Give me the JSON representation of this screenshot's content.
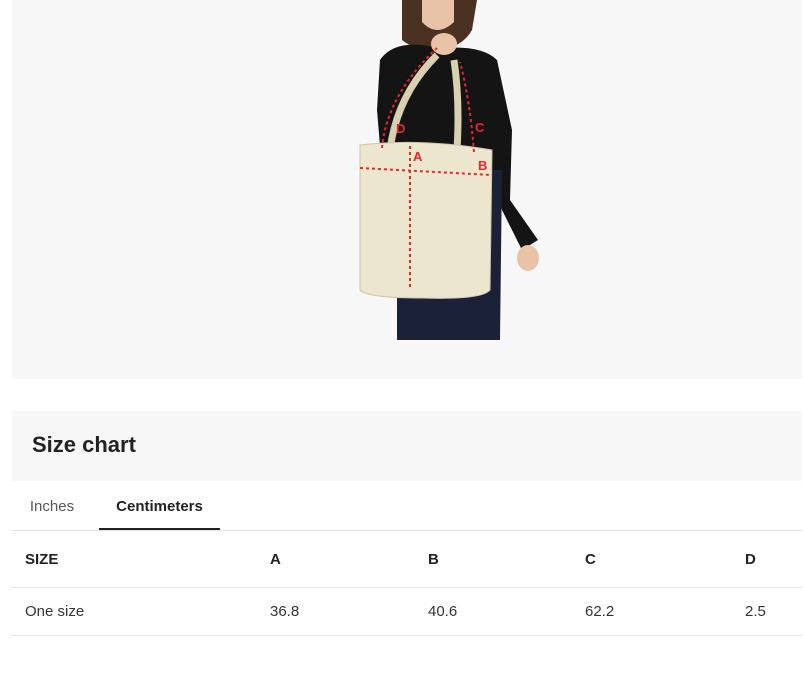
{
  "product_image": {
    "labels": [
      "A",
      "B",
      "C",
      "D"
    ]
  },
  "size_chart": {
    "title": "Size chart",
    "tabs": [
      {
        "label": "Inches",
        "active": false
      },
      {
        "label": "Centimeters",
        "active": true
      }
    ],
    "columns": [
      "SIZE",
      "A",
      "B",
      "C",
      "D"
    ],
    "rows": [
      [
        "One size",
        "36.8",
        "40.6",
        "62.2",
        "2.5"
      ]
    ]
  },
  "colors": {
    "panel_bg": "#f7f7f7",
    "measure_red": "#e8262c",
    "bag_canvas": "#ede6cf",
    "sweater": "#141414",
    "jeans": "#1b2238"
  }
}
